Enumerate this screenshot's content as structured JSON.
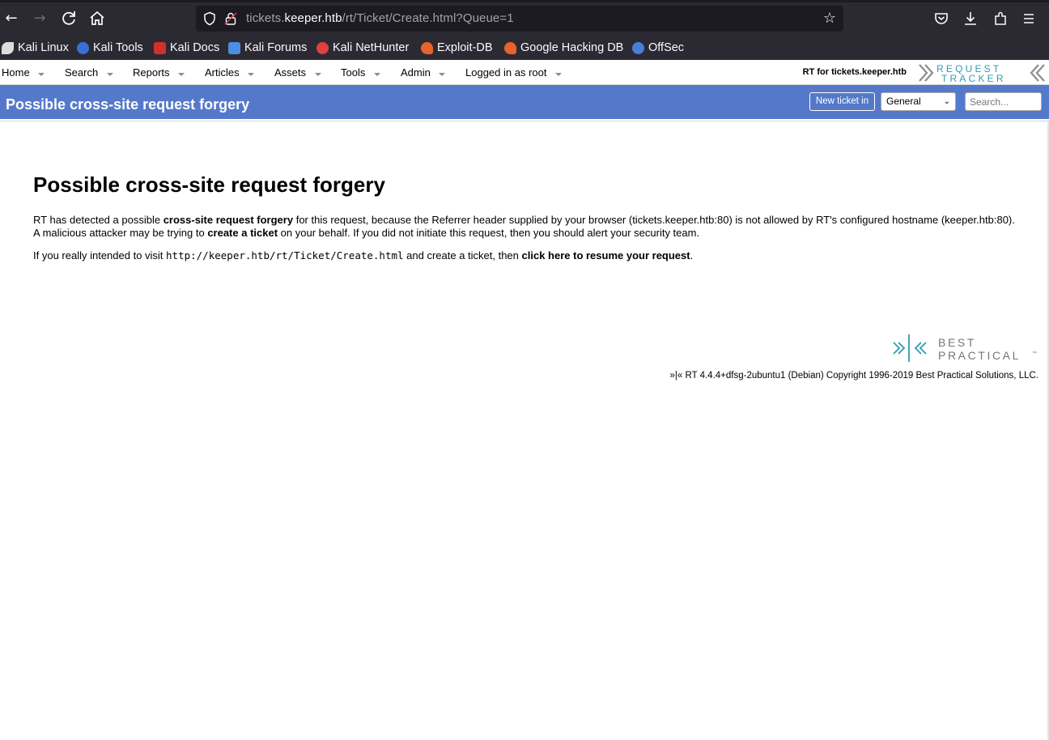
{
  "browser": {
    "url": {
      "prefix": "tickets.",
      "host": "keeper.htb",
      "path": "/rt/Ticket/Create.html?Queue=1"
    },
    "bookmarks": [
      {
        "label": "Kali Linux",
        "icon": "kali-dragon-icon",
        "color": "#dddddd"
      },
      {
        "label": "Kali Tools",
        "icon": "kali-tools-icon",
        "color": "#3a6fd8"
      },
      {
        "label": "Kali Docs",
        "icon": "kali-docs-icon",
        "color": "#d03030"
      },
      {
        "label": "Kali Forums",
        "icon": "kali-forums-icon",
        "color": "#4a90e2"
      },
      {
        "label": "Kali NetHunter",
        "icon": "nethunter-icon",
        "color": "#e04040"
      },
      {
        "label": "Exploit-DB",
        "icon": "exploit-db-icon",
        "color": "#e8632b"
      },
      {
        "label": "Google Hacking DB",
        "icon": "ghdb-icon",
        "color": "#e8632b"
      },
      {
        "label": "OffSec",
        "icon": "offsec-icon",
        "color": "#4a7fd8"
      }
    ]
  },
  "rt": {
    "menu": [
      {
        "label": "Home"
      },
      {
        "label": "Search"
      },
      {
        "label": "Reports"
      },
      {
        "label": "Articles"
      },
      {
        "label": "Assets"
      },
      {
        "label": "Tools"
      },
      {
        "label": "Admin"
      },
      {
        "label": "Logged in as root"
      }
    ],
    "rt_for": "RT for tickets.keeper.htb",
    "logo_text": {
      "line1": "REQUEST",
      "line2": "TRACKER"
    },
    "header": {
      "title": "Possible cross-site request forgery",
      "new_ticket_label": "New ticket in",
      "queue_selected": "General",
      "search_placeholder": "Search..."
    },
    "content": {
      "heading": "Possible cross-site request forgery",
      "p1_a": "RT has detected a possible ",
      "p1_b": "cross-site request forgery",
      "p1_c": " for this request, because the Referrer header supplied by your browser (tickets.keeper.htb:80) is not allowed by RT's configured hostname (keeper.htb:80).",
      "p2_a": "A malicious attacker may be trying to ",
      "p2_b": "create a ticket",
      "p2_c": " on your behalf. If you did not initiate this request, then you should alert your security team.",
      "p3_a": "If you really intended to visit ",
      "p3_url": "http://keeper.htb/rt/Ticket/Create.html",
      "p3_b": " and create a ticket, then ",
      "p3_link": "click here to resume your request",
      "p3_c": "."
    },
    "footer": {
      "bp_line1": "BEST",
      "bp_line2": "PRACTICAL",
      "tm": "™",
      "copyright": "»|« RT 4.4.4+dfsg-2ubuntu1 (Debian) Copyright 1996-2019 Best Practical Solutions, LLC."
    },
    "colors": {
      "header_blue": "#5579ca",
      "logo_teal": "#2f9db3"
    }
  }
}
